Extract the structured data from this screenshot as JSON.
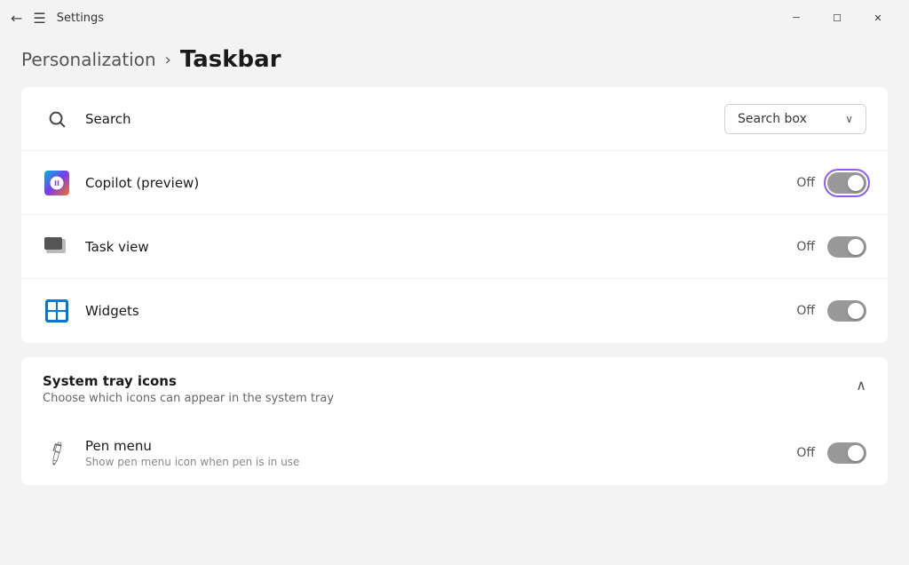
{
  "window": {
    "title": "Settings",
    "minimize_label": "─",
    "maximize_label": "☐",
    "close_label": "✕"
  },
  "breadcrumb": {
    "parent": "Personalization",
    "separator": "›",
    "current": "Taskbar"
  },
  "rows": [
    {
      "id": "search",
      "label": "Search",
      "icon_type": "search",
      "control_type": "dropdown",
      "dropdown_value": "Search box",
      "dropdown_arrow": "∨"
    },
    {
      "id": "copilot",
      "label": "Copilot (preview)",
      "icon_type": "copilot",
      "control_type": "toggle",
      "toggle_state": "Off",
      "focused": true
    },
    {
      "id": "taskview",
      "label": "Task view",
      "icon_type": "taskview",
      "control_type": "toggle",
      "toggle_state": "Off",
      "focused": false
    },
    {
      "id": "widgets",
      "label": "Widgets",
      "icon_type": "widgets",
      "control_type": "toggle",
      "toggle_state": "Off",
      "focused": false
    }
  ],
  "system_tray": {
    "title": "System tray icons",
    "subtitle": "Choose which icons can appear in the system tray",
    "chevron": "∧"
  },
  "pen_menu": {
    "label": "Pen menu",
    "sublabel": "Show pen menu icon when pen is in use",
    "toggle_state": "Off"
  }
}
